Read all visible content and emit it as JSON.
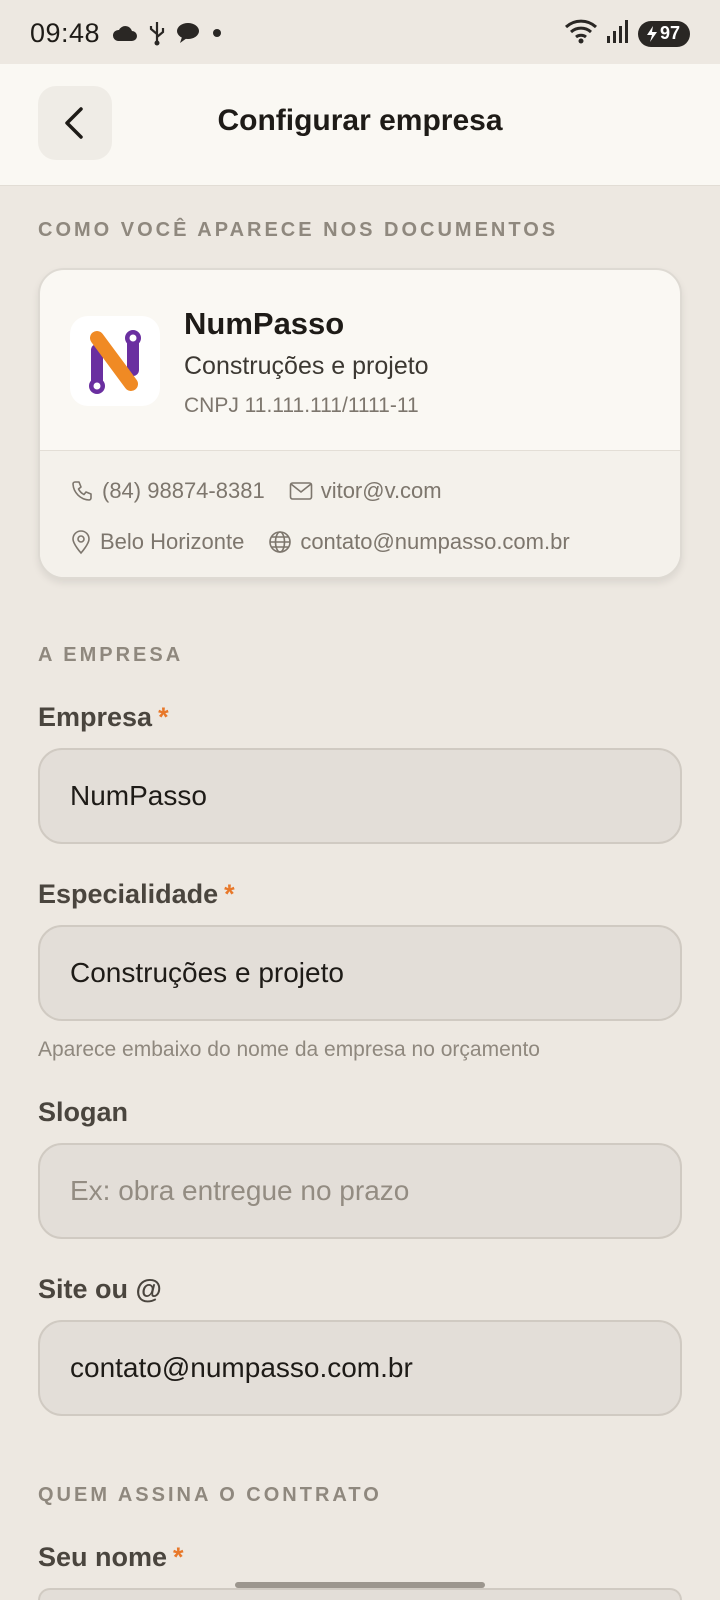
{
  "status_bar": {
    "time": "09:48",
    "battery": "97",
    "left_icons": [
      "cloud-icon",
      "usb-icon",
      "chat-bubble-icon",
      "dot-icon"
    ],
    "right_icons": [
      "wifi-icon",
      "signal-icon",
      "battery-icon"
    ]
  },
  "header": {
    "title": "Configurar empresa",
    "back_icon": "chevron-left-icon"
  },
  "preview": {
    "section_label": "COMO VOCÊ APARECE NOS DOCUMENTOS",
    "company_name": "NumPasso",
    "specialty": "Construções e projeto",
    "cnpj": "CNPJ 11.111.111/1111-11",
    "phone": "(84) 98874-8381",
    "email": "vitor@v.com",
    "city": "Belo Horizonte",
    "site": "contato@numpasso.com.br",
    "logo_colors": {
      "orange": "#F08A24",
      "purple": "#6A2FA0"
    }
  },
  "company_section": {
    "label": "A EMPRESA",
    "empresa": {
      "label": "Empresa",
      "required_mark": "*",
      "value": "NumPasso"
    },
    "especialidade": {
      "label": "Especialidade",
      "required_mark": "*",
      "value": "Construções e projeto",
      "helper": "Aparece embaixo do nome da empresa no orçamento"
    },
    "slogan": {
      "label": "Slogan",
      "value": "",
      "placeholder": "Ex: obra entregue no prazo"
    },
    "site": {
      "label": "Site ou @",
      "value": "contato@numpasso.com.br"
    }
  },
  "signer_section": {
    "label": "QUEM ASSINA O CONTRATO",
    "seu_nome": {
      "label": "Seu nome",
      "required_mark": "*",
      "value": ""
    }
  },
  "colors": {
    "accent_required": "#E8782A",
    "background": "#EDE8E1",
    "card": "#FAF8F3"
  }
}
